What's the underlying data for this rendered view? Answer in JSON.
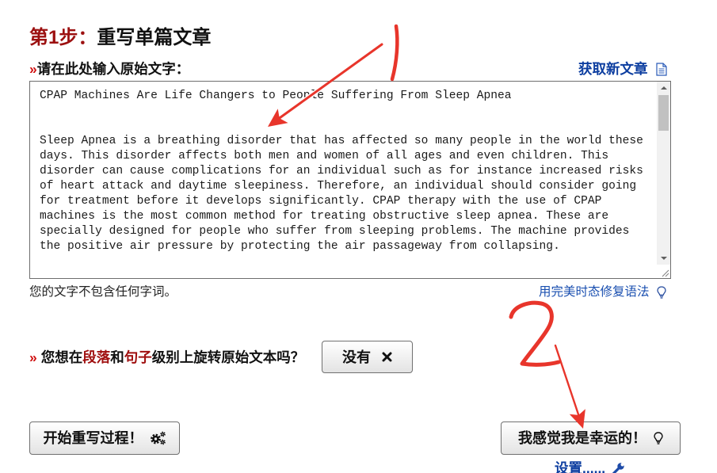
{
  "step": {
    "number_label": "第1步：",
    "title": "重写单篇文章"
  },
  "input": {
    "prefix": "»",
    "label": "请在此处输入原始文字：",
    "fetch_article_link": "获取新文章",
    "text": "CPAP Machines Are Life Changers to People Suffering From Sleep Apnea\n\n\nSleep Apnea is a breathing disorder that has affected so many people in the world these\ndays. This disorder affects both men and women of all ages and even children. This\ndisorder can cause complications for an individual such as for instance increased risks\nof heart attack and daytime sleepiness. Therefore, an individual should consider going\nfor treatment before it develops significantly. CPAP therapy with the use of CPAP\nmachines is the most common method for treating obstructive sleep apnea. These are\nspecially designed for people who suffer from sleeping problems. The machine provides\nthe positive air pressure by protecting the air passageway from collapsing.",
    "word_count_status": "您的文字不包含任何字词。",
    "fix_grammar_link": "用完美时态修复语法"
  },
  "spin_question": {
    "prefix": "»",
    "parts": [
      "您想在",
      "段落",
      "和",
      "句子",
      "级别上旋转原始文本吗？"
    ],
    "toggle_label": "没有"
  },
  "actions": {
    "start_label": "开始重写过程！",
    "lucky_label": "我感觉我是幸运的！",
    "settings_link": "设置......"
  },
  "icons": {
    "fetch_article": "document-icon",
    "fix_grammar": "lightbulb-icon",
    "toggle": "close-icon",
    "start": "gears-icon",
    "lucky": "lightbulb-icon",
    "settings": "wrench-icon"
  },
  "colors": {
    "step_red": "#9c1010",
    "marker_red": "#d01212",
    "emphasis_red": "#a01010",
    "link_blue": "#0d3ea0",
    "link_blue_light": "#1a4fb0",
    "button_border": "#707070",
    "annotation_red": "#e8352b"
  },
  "annotations": [
    {
      "label": "1"
    },
    {
      "label": "2"
    }
  ]
}
